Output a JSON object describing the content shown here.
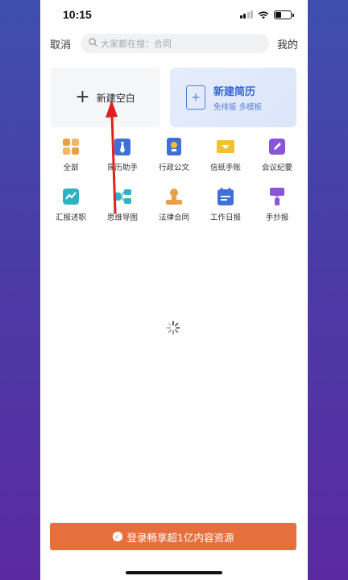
{
  "status": {
    "time": "10:15"
  },
  "topbar": {
    "cancel_label": "取消",
    "search_placeholder": "大家都在搜：合同",
    "mine_label": "我的"
  },
  "cards": {
    "blank_label": "新建空白",
    "resume_title": "新建简历",
    "resume_subtitle": "免排版 多模板"
  },
  "grid": {
    "items": [
      {
        "label": "全部",
        "icon": "grid-icon",
        "color": "#e8a048"
      },
      {
        "label": "简历助手",
        "icon": "tie-icon",
        "color": "#3f6fd8"
      },
      {
        "label": "行政公文",
        "icon": "badge-icon",
        "color": "#3f6fd8"
      },
      {
        "label": "信纸手账",
        "icon": "envelope-icon",
        "color": "#f2c12e"
      },
      {
        "label": "会议纪要",
        "icon": "pencil-icon",
        "color": "#8a55d8"
      },
      {
        "label": "汇报述职",
        "icon": "chart-icon",
        "color": "#2fb3c4"
      },
      {
        "label": "思维导图",
        "icon": "mindmap-icon",
        "color": "#2fb3c4"
      },
      {
        "label": "法律合同",
        "icon": "seal-icon",
        "color": "#e8a048"
      },
      {
        "label": "工作日报",
        "icon": "calendar-icon",
        "color": "#3f6fd8"
      },
      {
        "label": "手抄报",
        "icon": "brush-icon",
        "color": "#8a55d8"
      }
    ]
  },
  "bottom": {
    "login_label": "登录畅享超1亿内容资源"
  },
  "colors": {
    "accent_orange": "#e76f3e",
    "arrow_red": "#e0201e",
    "blue": "#3f6fd8"
  }
}
